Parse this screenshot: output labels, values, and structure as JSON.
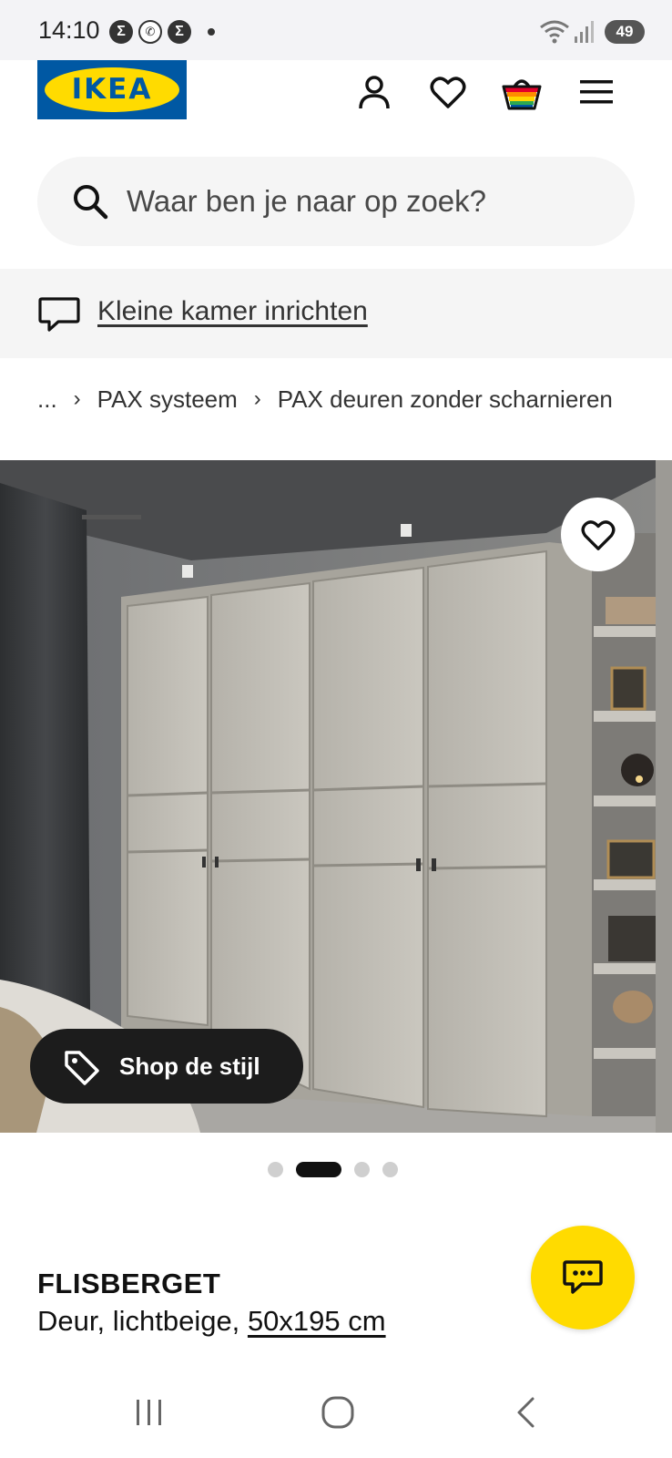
{
  "status_bar": {
    "time": "14:10",
    "battery": "49",
    "notification_icons": [
      "samsung-icon",
      "whatsapp-icon",
      "samsung-icon"
    ]
  },
  "header": {
    "logo_text": "IKEA",
    "icons": [
      "account-icon",
      "wishlist-heart-icon",
      "basket-icon",
      "menu-icon"
    ]
  },
  "search": {
    "placeholder": "Waar ben je naar op zoek?"
  },
  "banner": {
    "link_text": "Kleine kamer inrichten"
  },
  "breadcrumb": {
    "items": [
      "...",
      "PAX systeem",
      "PAX deuren zonder scharnieren"
    ]
  },
  "hero": {
    "shop_style_label": "Shop de stijl",
    "image_count": 4,
    "active_index": 1
  },
  "product": {
    "name": "FLISBERGET",
    "description": "Deur, lichtbeige,",
    "size": "50x195 cm"
  },
  "colors": {
    "ikea_blue": "#0058a3",
    "ikea_yellow": "#ffdb00",
    "dark": "#111111",
    "light_gray": "#f5f5f5"
  }
}
